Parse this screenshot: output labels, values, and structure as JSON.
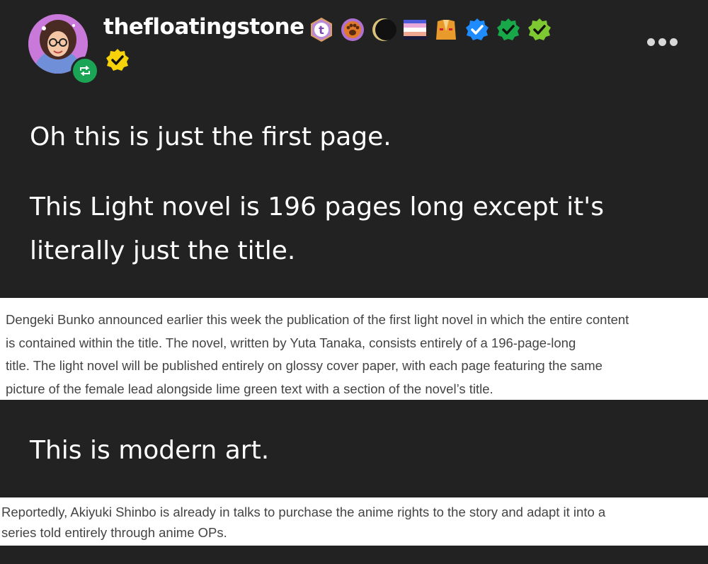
{
  "post": {
    "username": "thefloatingstone",
    "badges": [
      {
        "icon": "tumblr-t-badge-icon",
        "color": "#b98ad8"
      },
      {
        "icon": "paw-badge-icon",
        "color": "#e07a2a"
      },
      {
        "icon": "crescent-moon-badge-icon",
        "color": "#111111"
      },
      {
        "icon": "gradient-flag-badge-icon",
        "color": "#f0a0c0"
      },
      {
        "icon": "vest-badge-icon",
        "color": "#e89a2a"
      },
      {
        "icon": "blue-check-badge-icon",
        "color": "#1e8bff"
      },
      {
        "icon": "green-check-badge-icon",
        "color": "#18a84a"
      },
      {
        "icon": "lime-check-badge-icon",
        "color": "#7ec832"
      },
      {
        "icon": "yellow-check-badge-icon",
        "color": "#f5d20a"
      }
    ],
    "paragraph1": "Oh this is just the first page.",
    "paragraph2_line1": "This Light novel is 196 pages long except it's",
    "paragraph2_line2": "literally just the title.",
    "clip1": {
      "line1": "Dengeki Bunko announced earlier this week the publication of the first light novel in which the entire content",
      "line2": "is contained within the title. The novel, written by Yuta Tanaka, consists entirely of a 196-page-long",
      "line3": "title. The light novel will be published entirely on glossy cover paper, with each page featuring the same",
      "line4": "picture of the female lead alongside lime green text with a section of the novel’s title."
    },
    "paragraph3": "This is modern art.",
    "clip2": {
      "line1": "Reportedly, Akiyuki Shinbo is already in talks to purchase the anime rights to the story and adapt it into a",
      "line2": "series told entirely through anime OPs."
    }
  }
}
